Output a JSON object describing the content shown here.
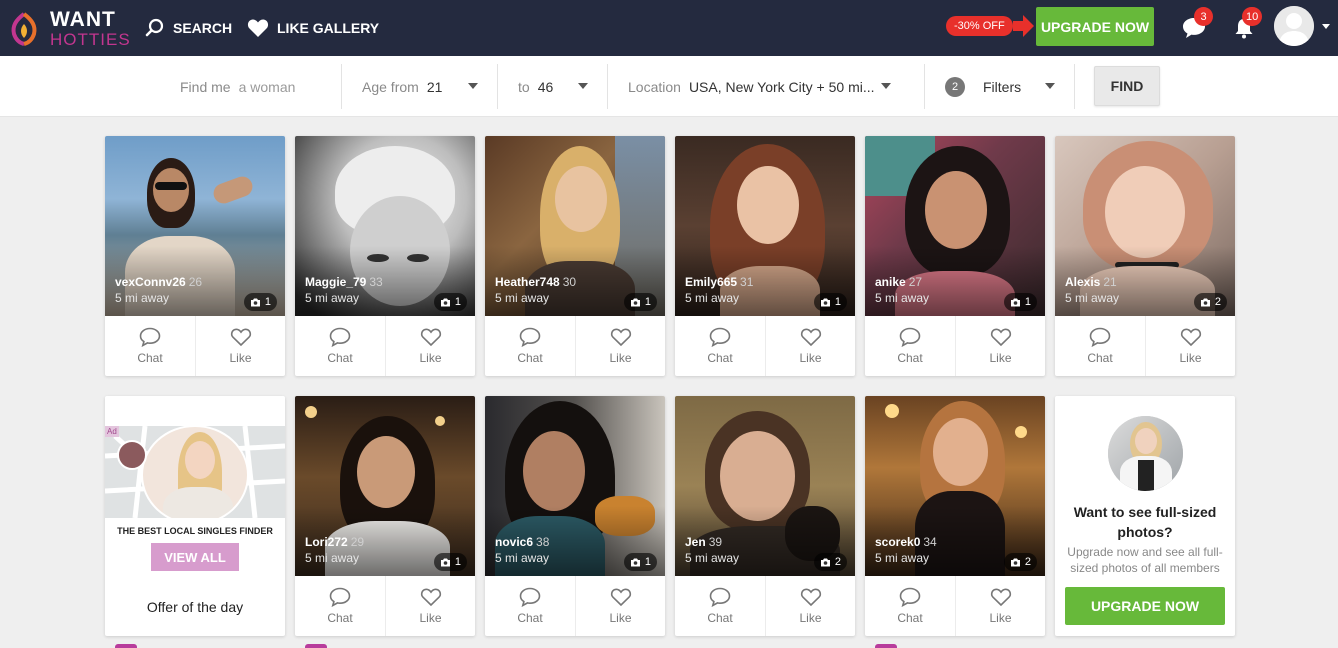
{
  "brand": {
    "line1": "WANT",
    "line2": "HOTTIES",
    "colors": {
      "header": "#242a3f",
      "accent": "#c2368f",
      "upgrade": "#67b93a",
      "badge": "#e8302b"
    }
  },
  "nav": {
    "search_label": "SEARCH",
    "like_gallery_label": "LIKE GALLERY"
  },
  "promo": {
    "discount": "-30% OFF",
    "upgrade_label": "UPGRADE NOW"
  },
  "notifications": {
    "messages_count": "3",
    "alerts_count": "10"
  },
  "filters": {
    "find_me_label": "Find me",
    "find_me_placeholder": "a woman",
    "age_from_label": "Age from",
    "age_from_value": "21",
    "age_to_label": "to",
    "age_to_value": "46",
    "location_label": "Location",
    "location_value": "USA, New York City + 50 mi...",
    "filters_count": "2",
    "filters_label": "Filters",
    "find_button": "FIND"
  },
  "card_actions": {
    "chat": "Chat",
    "like": "Like"
  },
  "profiles": [
    {
      "name": "vexConnv26",
      "age": "26",
      "distance": "5 mi away",
      "photos": "1"
    },
    {
      "name": "Maggie_79",
      "age": "33",
      "distance": "5 mi away",
      "photos": "1"
    },
    {
      "name": "Heather748",
      "age": "30",
      "distance": "5 mi away",
      "photos": "1"
    },
    {
      "name": "Emily665",
      "age": "31",
      "distance": "5 mi away",
      "photos": "1"
    },
    {
      "name": "anike",
      "age": "27",
      "distance": "5 mi away",
      "photos": "1"
    },
    {
      "name": "Alexis",
      "age": "21",
      "distance": "5 mi away",
      "photos": "2"
    },
    {
      "name": "Lori272",
      "age": "29",
      "distance": "5 mi away",
      "photos": "1"
    },
    {
      "name": "novic6",
      "age": "38",
      "distance": "5 mi away",
      "photos": "1"
    },
    {
      "name": "Jen",
      "age": "39",
      "distance": "5 mi away",
      "photos": "2"
    },
    {
      "name": "scorek0",
      "age": "34",
      "distance": "5 mi away",
      "photos": "2"
    }
  ],
  "ad": {
    "mark": "Ad",
    "headline": "THE BEST LOCAL SINGLES FINDER",
    "button": "VIEW ALL",
    "footer": "Offer of the day"
  },
  "upsell": {
    "title": "Want to see full-sized photos?",
    "text": "Upgrade now and see all full-sized photos of all members",
    "button": "UPGRADE NOW"
  }
}
